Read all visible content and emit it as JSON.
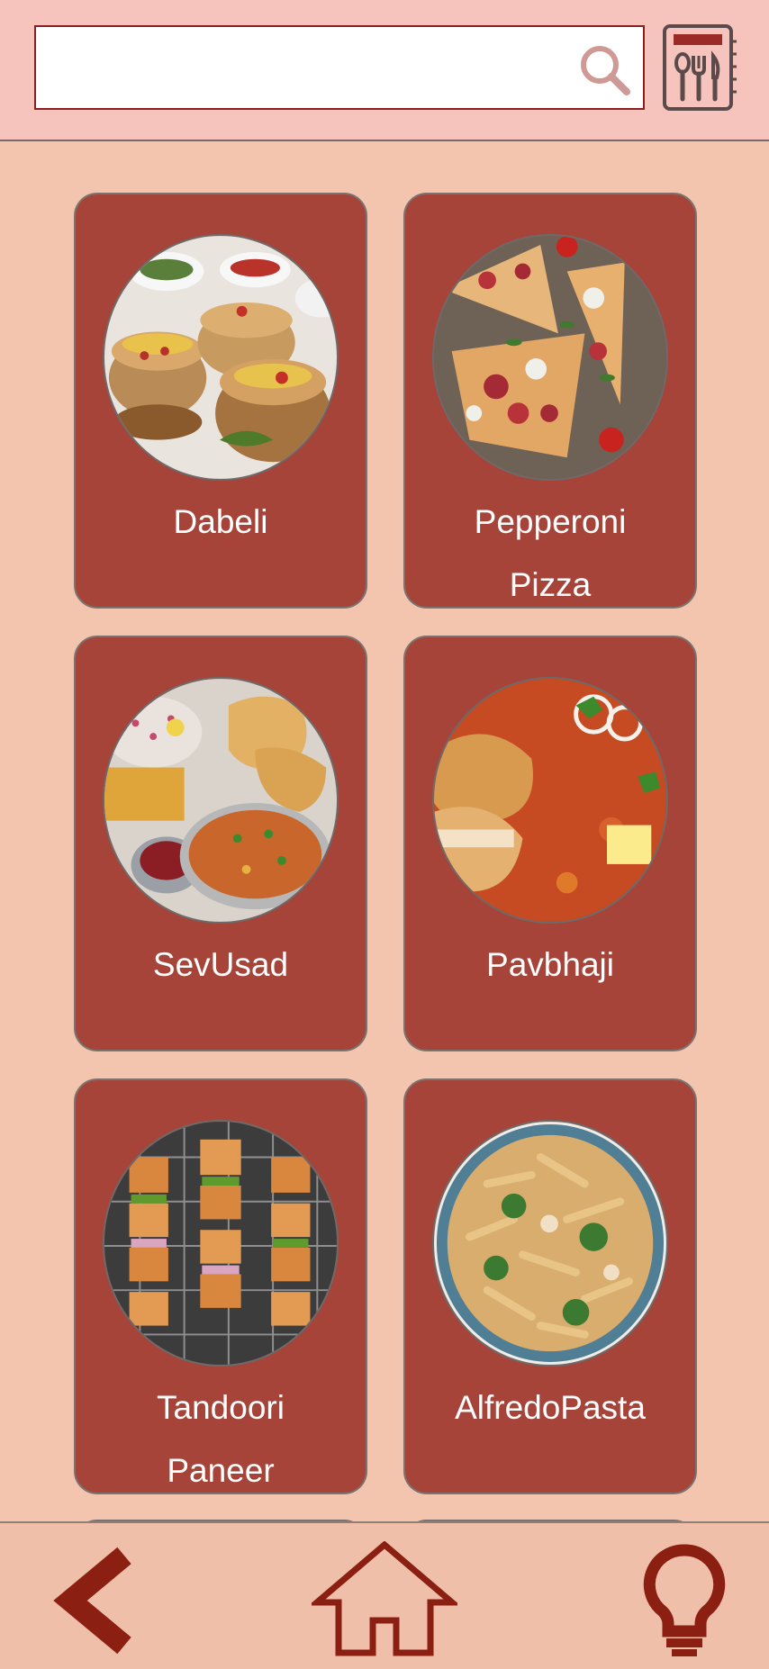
{
  "search": {
    "value": "",
    "placeholder": ""
  },
  "header": {
    "search_icon": "search-icon",
    "menu_icon": "recipe-book-icon"
  },
  "dishes": [
    {
      "name_line1": "Dabeli",
      "name_line2": ""
    },
    {
      "name_line1": "Pepperoni",
      "name_line2": "Pizza"
    },
    {
      "name_line1": "SevUsad",
      "name_line2": ""
    },
    {
      "name_line1": "Pavbhaji",
      "name_line2": ""
    },
    {
      "name_line1": "Tandoori",
      "name_line2": "Paneer"
    },
    {
      "name_line1": "AlfredoPasta",
      "name_line2": ""
    }
  ],
  "nav": {
    "back_icon": "back-arrow-icon",
    "home_icon": "home-icon",
    "tips_icon": "lightbulb-icon"
  },
  "colors": {
    "header_bg": "#f6c3bd",
    "page_bg": "#f3c4ae",
    "card_bg": "#a6443a",
    "nav_bg": "#efbfa9",
    "icon_dark_red": "#8a1f12"
  }
}
